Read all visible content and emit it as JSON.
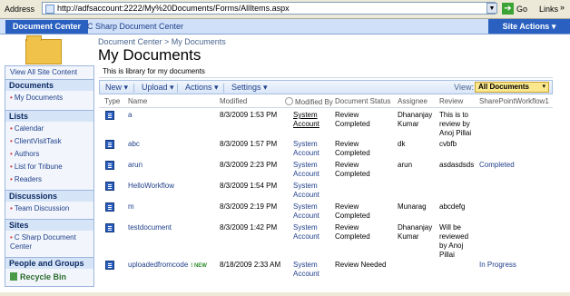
{
  "browser": {
    "address_label": "Address",
    "url": "http://adfsaccount:2222/My%20Documents/Forms/AllItems.aspx",
    "go_label": "Go",
    "links_label": "Links",
    "links_chevron": "»"
  },
  "tabs": [
    {
      "label": "Document Center"
    },
    {
      "label": "C Sharp Document Center"
    }
  ],
  "site_actions": "Site Actions ▾",
  "breadcrumb": "Document Center > My Documents",
  "page_title": "My Documents",
  "sidebar": {
    "view_all": "View All Site Content",
    "sections": [
      {
        "heading": "Documents",
        "items": [
          "My Documents"
        ]
      },
      {
        "heading": "Lists",
        "items": [
          "Calendar",
          "ClientVisitTask",
          "Authors",
          "List for Tribune",
          "Readers"
        ]
      },
      {
        "heading": "Discussions",
        "items": [
          "Team Discussion"
        ]
      },
      {
        "heading": "Sites",
        "items": [
          "C Sharp Document Center"
        ]
      },
      {
        "heading": "People and Groups",
        "items": []
      }
    ],
    "recycle_bin": "Recycle Bin"
  },
  "description": "This is library for my documents",
  "toolbar": {
    "new": "New ▾",
    "upload": "Upload ▾",
    "actions": "Actions ▾",
    "settings": "Settings ▾",
    "view_label": "View:",
    "view_value": "All Documents",
    "view_caret": "▾"
  },
  "columns": [
    "Type",
    "Name",
    "Modified",
    "Modified By",
    "Document Status",
    "Assignee",
    "Review",
    "SharePointWorkflow1"
  ],
  "rows": [
    {
      "name": "a",
      "modified": "8/3/2009 1:53 PM",
      "modified_by": "System Account",
      "status": "Review Completed",
      "assignee": "Dhananjay Kumar",
      "review": "This is to review by Anoj Pillai",
      "workflow": "",
      "is_new": false
    },
    {
      "name": "abc",
      "modified": "8/3/2009 1:57 PM",
      "modified_by": "System Account",
      "status": "Review Completed",
      "assignee": "dk",
      "review": "cvbfb",
      "workflow": "",
      "is_new": false
    },
    {
      "name": "arun",
      "modified": "8/3/2009 2:23 PM",
      "modified_by": "System Account",
      "status": "Review Completed",
      "assignee": "arun",
      "review": "asdasdsds",
      "workflow": "Completed",
      "is_new": false
    },
    {
      "name": "HelloWorkflow",
      "modified": "8/3/2009 1:54 PM",
      "modified_by": "System Account",
      "status": "",
      "assignee": "",
      "review": "",
      "workflow": "",
      "is_new": false
    },
    {
      "name": "m",
      "modified": "8/3/2009 2:19 PM",
      "modified_by": "System Account",
      "status": "Review Completed",
      "assignee": "Munarag",
      "review": "abcdefg",
      "workflow": "",
      "is_new": false
    },
    {
      "name": "testdocument",
      "modified": "8/3/2009 1:42 PM",
      "modified_by": "System Account",
      "status": "Review Completed",
      "assignee": "Dhananjay Kumar",
      "review": "Will be reviewed by Anoj Pillai",
      "workflow": "",
      "is_new": false
    },
    {
      "name": "uploadedfromcode",
      "modified": "8/18/2009 2:33 AM",
      "modified_by": "System Account",
      "status": "Review Needed",
      "assignee": "",
      "review": "",
      "workflow": "In Progress",
      "is_new": true
    }
  ],
  "new_badge": "! NEW"
}
